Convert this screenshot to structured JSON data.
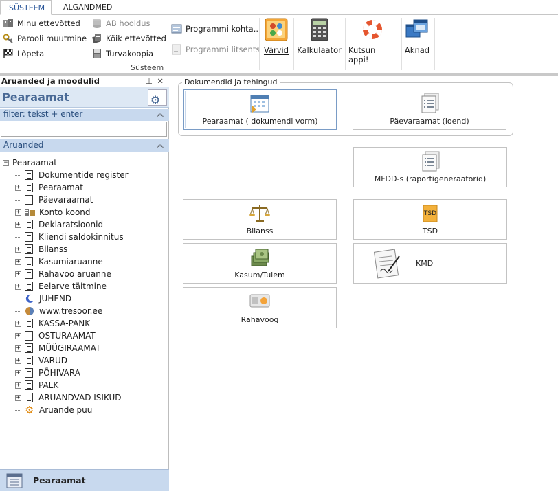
{
  "tabs": [
    {
      "label": "SÜSTEEM",
      "active": true
    },
    {
      "label": "ALGANDMED",
      "active": false
    }
  ],
  "ribbon": {
    "small_col1": [
      "Minu ettevõtted",
      "Parooli muutmine",
      "Lõpeta"
    ],
    "small_col2": [
      {
        "label": "AB hooldus",
        "disabled": true
      },
      {
        "label": "Kõik ettevõtted",
        "disabled": false
      },
      {
        "label": "Turvakoopia",
        "disabled": false
      }
    ],
    "small_col3": [
      {
        "label": "Programmi kohta...",
        "disabled": false
      },
      {
        "label": "Programmi litsents",
        "disabled": true
      }
    ],
    "group_label": "Süsteem",
    "big_buttons": [
      "Värvid",
      "Kalkulaator",
      "Kutsun appi!",
      "Aknad"
    ]
  },
  "left_panel": {
    "header": "Aruanded ja moodulid",
    "pin_icon": "pin-icon",
    "title": "Pearaamat",
    "filter_label": "filter: tekst + enter",
    "filter_value": "",
    "reports_label": "Aruanded",
    "tree_root": "Pearaamat",
    "tree_items": [
      {
        "label": "Dokumentide register",
        "expandable": false,
        "icon": "document-icon"
      },
      {
        "label": "Pearaamat",
        "expandable": true,
        "icon": "document-icon"
      },
      {
        "label": "Päevaraamat",
        "expandable": false,
        "icon": "document-icon"
      },
      {
        "label": "Konto koond",
        "expandable": true,
        "icon": "accounts-icon"
      },
      {
        "label": "Deklaratsioonid",
        "expandable": true,
        "icon": "document-icon"
      },
      {
        "label": "Kliendi saldokinnitus",
        "expandable": false,
        "icon": "document-icon"
      },
      {
        "label": "Bilanss",
        "expandable": true,
        "icon": "document-icon"
      },
      {
        "label": "Kasumiaruanne",
        "expandable": true,
        "icon": "document-icon"
      },
      {
        "label": "Rahavoo aruanne",
        "expandable": true,
        "icon": "document-icon"
      },
      {
        "label": "Eelarve täitmine",
        "expandable": true,
        "icon": "document-icon"
      },
      {
        "label": "JUHEND",
        "expandable": false,
        "icon": "moon-icon"
      },
      {
        "label": "www.tresoor.ee",
        "expandable": false,
        "icon": "globe-icon"
      },
      {
        "label": "KASSA-PANK",
        "expandable": true,
        "icon": "document-icon"
      },
      {
        "label": "OSTURAAMAT",
        "expandable": true,
        "icon": "document-icon"
      },
      {
        "label": "MÜÜGIRAAMAT",
        "expandable": true,
        "icon": "document-icon"
      },
      {
        "label": "VARUD",
        "expandable": true,
        "icon": "document-icon"
      },
      {
        "label": "PÕHIVARA",
        "expandable": true,
        "icon": "document-icon"
      },
      {
        "label": "PALK",
        "expandable": true,
        "icon": "document-icon"
      },
      {
        "label": "ARUANDVAD ISIKUD",
        "expandable": true,
        "icon": "document-icon"
      },
      {
        "label": "Aruande puu",
        "expandable": false,
        "icon": "gear-icon"
      }
    ],
    "footer_label": "Pearaamat"
  },
  "main": {
    "group_legend": "Dokumendid ja tehingud",
    "tiles": [
      {
        "label": "Pearaamat ( dokumendi vorm)",
        "icon": "calendar-form-icon"
      },
      {
        "label": "Päevaraamat (loend)",
        "icon": "document-list-icon"
      },
      {
        "label": "MFDD-s (raportigeneraatorid)",
        "icon": "document-list-icon"
      },
      {
        "label": "Bilanss",
        "icon": "scales-icon"
      },
      {
        "label": "TSD",
        "icon": "tsd-icon"
      },
      {
        "label": "Kasum/Tulem",
        "icon": "money-icon"
      },
      {
        "label": "KMD",
        "icon": "signed-document-icon"
      },
      {
        "label": "Rahavoog",
        "icon": "cash-flow-icon"
      }
    ],
    "tsd_icon_text": "TSD"
  },
  "colors": {
    "accent": "#2b579a",
    "panel_blue": "#dde8f4",
    "bar_blue": "#c8d9ee"
  }
}
